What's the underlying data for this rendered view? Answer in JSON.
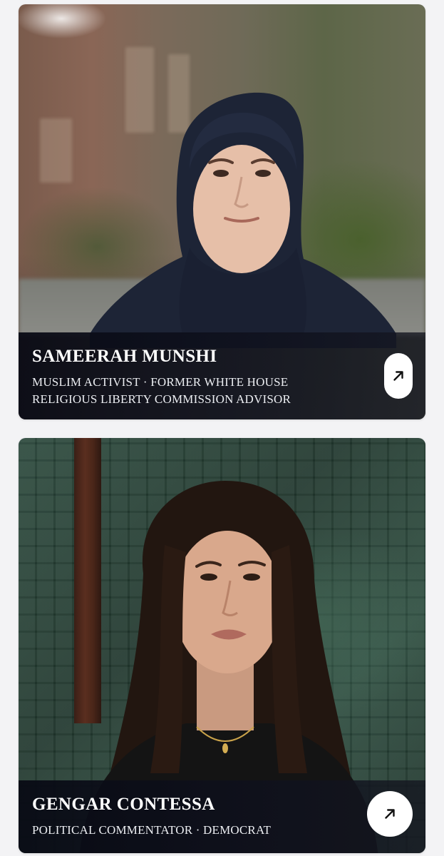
{
  "profiles": [
    {
      "name": "SAMEERAH MUNSHI",
      "subtitle": "MUSLIM ACTIVIST · FORMER WHITE HOUSE RELIGIOUS LIBERTY COMMISSION ADVISOR",
      "action_icon": "arrow-up-right-icon"
    },
    {
      "name": "GENGAR CONTESSA",
      "subtitle": "POLITICAL COMMENTATOR · DEMOCRAT",
      "action_icon": "arrow-up-right-icon"
    }
  ],
  "colors": {
    "page_background": "#f3f3f5",
    "caption_background": "#0c0e1a",
    "caption_text": "#ffffff",
    "button_background": "#ffffff",
    "button_icon": "#111111"
  }
}
